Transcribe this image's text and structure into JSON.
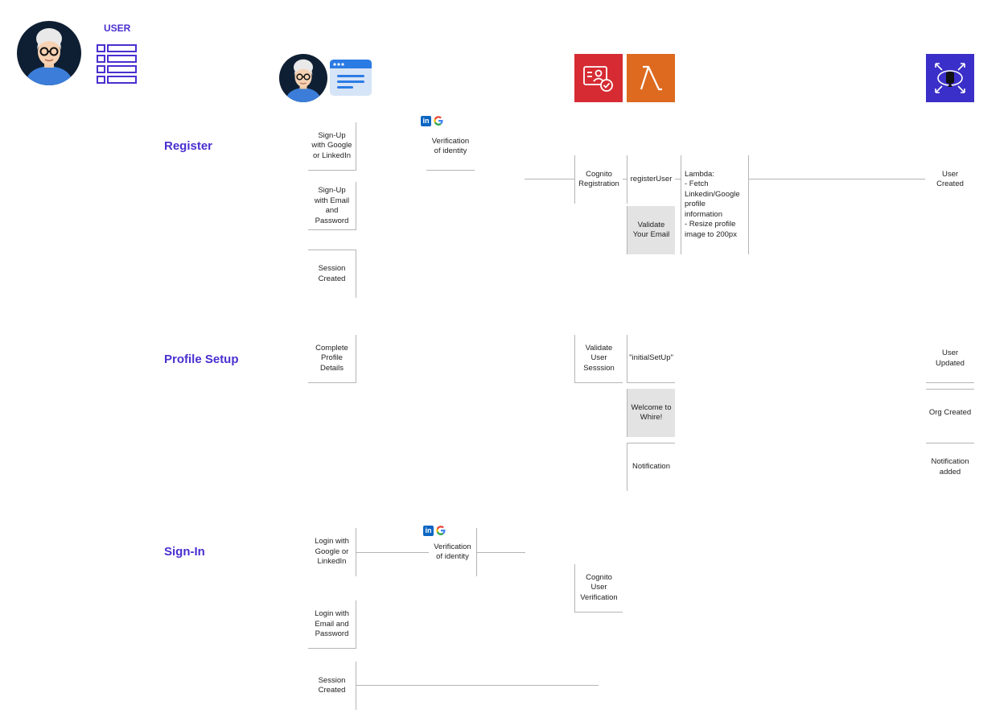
{
  "header": {
    "user_label": "USER"
  },
  "sections": {
    "register": "Register",
    "profile_setup": "Profile Setup",
    "sign_in": "Sign-In"
  },
  "register": {
    "signup_social": "Sign-Up with Google or LinkedIn",
    "signup_email": "Sign-Up with Email and Password",
    "session_created": "Session Created",
    "verification": "Verification of identity",
    "cognito_registration": "Cognito Registration",
    "register_user": "registerUser",
    "validate_email": "Validate Your Email",
    "lambda_notes": "Lambda:\n- Fetch Linkedin/Google profile information\n- Resize profile image to 200px",
    "user_created": "User Created"
  },
  "profile": {
    "complete_profile": "Complete Profile Details",
    "validate_session": "Validate User Sesssion",
    "initial_setup": "\"initialSetUp\"",
    "welcome": "Welcome to Whire!",
    "notification": "Notification",
    "user_updated": "User Updated",
    "org_created": "Org Created",
    "notification_added": "Notification added"
  },
  "signin": {
    "login_social": "Login with Google or LinkedIn",
    "verification": "Verification of identity",
    "login_email": "Login with Email and Password",
    "cognito_verification": "Cognito User Verification",
    "session_created": "Session Created"
  },
  "icons": {
    "cognito_tile": "cognito-icon",
    "lambda_tile": "lambda-icon",
    "database_tile": "database-icon",
    "linkedin": "linkedin-icon",
    "google": "google-icon"
  },
  "colors": {
    "accent": "#4a2fd0",
    "cognito": "#d62b33",
    "lambda": "#dd6a1f",
    "database": "#3b2fc9",
    "grey_box": "#e3e3e3"
  }
}
